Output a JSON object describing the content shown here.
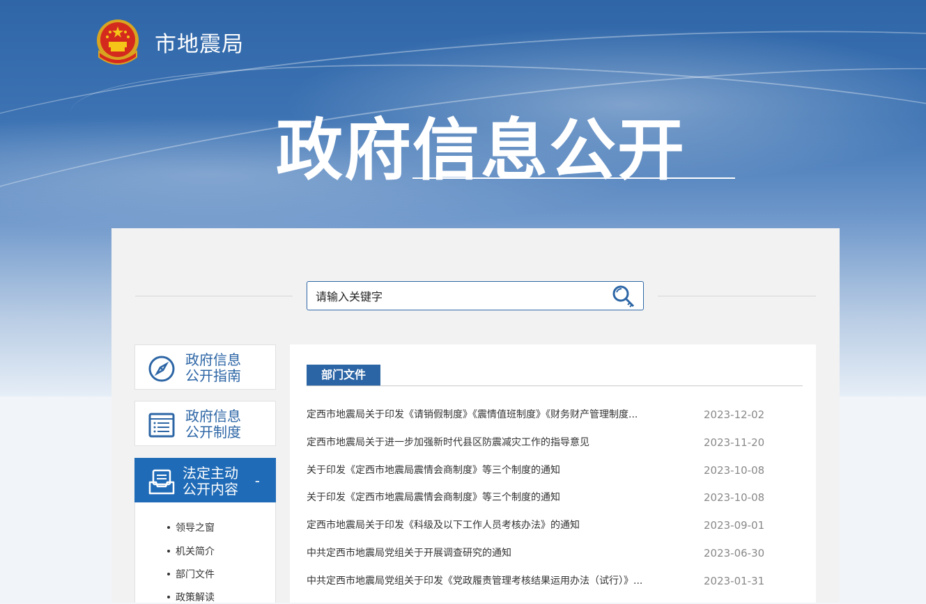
{
  "header": {
    "site_name": "市地震局",
    "hero_title": "政府信息公开"
  },
  "search": {
    "placeholder": "请输入关键字"
  },
  "sidebar": {
    "items": [
      {
        "label_line1": "政府信息",
        "label_line2": "公开指南",
        "icon": "compass-icon"
      },
      {
        "label_line1": "政府信息",
        "label_line2": "公开制度",
        "icon": "document-list-icon"
      },
      {
        "label_line1": "法定主动",
        "label_line2": "公开内容",
        "icon": "inbox-icon",
        "expanded_symbol": "-"
      }
    ],
    "sub_items": [
      "领导之窗",
      "机关简介",
      "部门文件",
      "政策解读"
    ]
  },
  "main": {
    "section_title": "部门文件",
    "articles": [
      {
        "title": "定西市地震局关于印发《请销假制度》《震情值班制度》《财务财产管理制度...",
        "date": "2023-12-02"
      },
      {
        "title": "定西市地震局关于进一步加强新时代县区防震减灾工作的指导意见",
        "date": "2023-11-20"
      },
      {
        "title": "关于印发《定西市地震局震情会商制度》等三个制度的通知",
        "date": "2023-10-08"
      },
      {
        "title": "关于印发《定西市地震局震情会商制度》等三个制度的通知",
        "date": "2023-10-08"
      },
      {
        "title": "定西市地震局关于印发《科级及以下工作人员考核办法》的通知",
        "date": "2023-09-01"
      },
      {
        "title": "中共定西市地震局党组关于开展调查研究的通知",
        "date": "2023-06-30"
      },
      {
        "title": "中共定西市地震局党组关于印发《党政履责管理考核结果运用办法（试行）》...",
        "date": "2023-01-31"
      }
    ]
  },
  "colors": {
    "primary_blue": "#2c65a5",
    "active_blue": "#1f6bb7",
    "date_gray": "#888888"
  }
}
